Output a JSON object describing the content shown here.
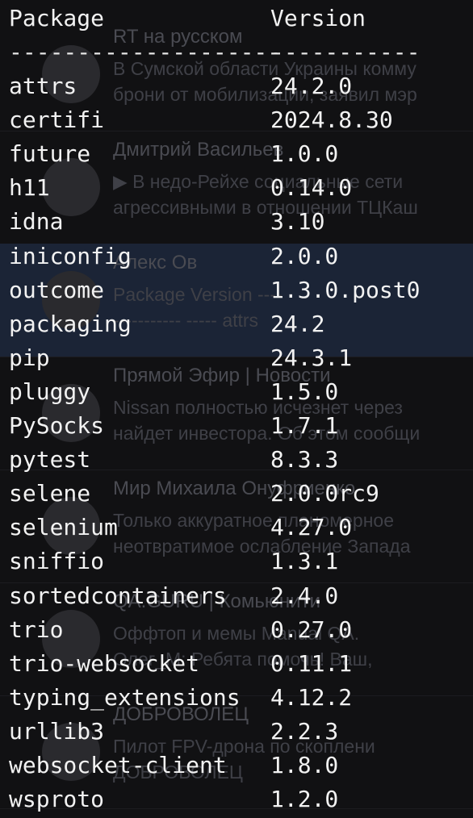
{
  "chats": [
    {
      "name": "RT на русском",
      "line1": "В Сумской области Украины комму",
      "line2": "брони от мобилизации, заявил мэр"
    },
    {
      "name": "Дмитрий Васильев",
      "line1": "▶ В недо-Рейхе социальные сети",
      "line2": "агрессивными в отношении ТЦКаш"
    },
    {
      "name": "Алекс Ов",
      "line1": "Package                   Version  ----",
      "line2": "----------- ----- attrs"
    },
    {
      "name": "Прямой Эфир | Новости",
      "line1": "Nissan полностью исчезнет через",
      "line2": "найдет инвестора. Об этом сообщи"
    },
    {
      "name": "Мир Михаила Онуфриенко",
      "line1": "Только аккуратное планомерное",
      "line2": "неотвратимое ослабление Запада"
    },
    {
      "name": "QA.GURU | Комьюнити",
      "line1": "Оффтоп и мемы   Manual QA.",
      "line2": "Олег_М: Ребята помочь! Ваш,"
    },
    {
      "name": "ДОБРОВОЛЕЦ",
      "line1": "Пилот FPV-дрона по скоплени",
      "line2": "ДОБРОВОЛЕЦ"
    }
  ],
  "terminal": {
    "header": {
      "package": "Package",
      "version": "Version"
    },
    "separator": {
      "package": "--------------------",
      "version": "-----------"
    },
    "packages": [
      {
        "name": "attrs",
        "version": "24.2.0"
      },
      {
        "name": "certifi",
        "version": "2024.8.30"
      },
      {
        "name": "future",
        "version": "1.0.0"
      },
      {
        "name": "h11",
        "version": "0.14.0"
      },
      {
        "name": "idna",
        "version": "3.10"
      },
      {
        "name": "iniconfig",
        "version": "2.0.0"
      },
      {
        "name": "outcome",
        "version": "1.3.0.post0"
      },
      {
        "name": "packaging",
        "version": "24.2"
      },
      {
        "name": "pip",
        "version": "24.3.1"
      },
      {
        "name": "pluggy",
        "version": "1.5.0"
      },
      {
        "name": "PySocks",
        "version": "1.7.1"
      },
      {
        "name": "pytest",
        "version": "8.3.3"
      },
      {
        "name": "selene",
        "version": "2.0.0rc9"
      },
      {
        "name": "selenium",
        "version": "4.27.0"
      },
      {
        "name": "sniffio",
        "version": "1.3.1"
      },
      {
        "name": "sortedcontainers",
        "version": "2.4.0"
      },
      {
        "name": "trio",
        "version": "0.27.0"
      },
      {
        "name": "trio-websocket",
        "version": "0.11.1"
      },
      {
        "name": "typing_extensions",
        "version": "4.12.2"
      },
      {
        "name": "urllib3",
        "version": "2.2.3"
      },
      {
        "name": "websocket-client",
        "version": "1.8.0"
      },
      {
        "name": "wsproto",
        "version": "1.2.0"
      }
    ]
  }
}
